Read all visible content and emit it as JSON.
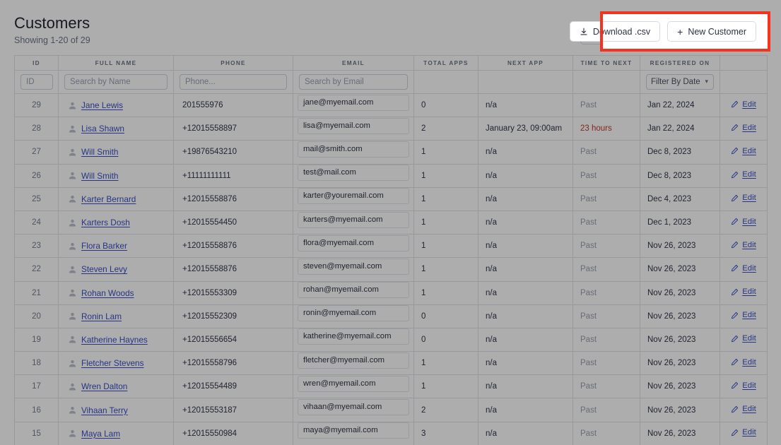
{
  "header": {
    "title": "Customers",
    "subtitle": "Showing 1-20 of 29",
    "download_label": "Download .csv",
    "new_customer_label": "New Customer",
    "download_icon": "download-icon",
    "new_icon": "plus-icon"
  },
  "highlight": {
    "color": "#f5321e"
  },
  "table": {
    "columns": [
      {
        "key": "id",
        "label": "ID"
      },
      {
        "key": "full_name",
        "label": "FULL NAME"
      },
      {
        "key": "phone",
        "label": "PHONE"
      },
      {
        "key": "email",
        "label": "EMAIL"
      },
      {
        "key": "total_apps",
        "label": "TOTAL APPS"
      },
      {
        "key": "next_app",
        "label": "NEXT APP"
      },
      {
        "key": "time_to_next",
        "label": "TIME TO NEXT"
      },
      {
        "key": "registered_on",
        "label": "REGISTERED ON"
      },
      {
        "key": "actions",
        "label": ""
      }
    ],
    "filters": {
      "id_placeholder": "ID",
      "name_placeholder": "Search by Name",
      "phone_placeholder": "Phone...",
      "email_placeholder": "Search by Email",
      "date_select_value": "Filter By Date"
    },
    "edit_label": "Edit",
    "rows": [
      {
        "id": "29",
        "full_name": "Jane Lewis",
        "phone": "201555976",
        "email": "jane@myemail.com",
        "total_apps": "0",
        "next_app": "n/a",
        "time_to_next": "Past",
        "time_state": "past",
        "registered_on": "Jan 22, 2024"
      },
      {
        "id": "28",
        "full_name": "Lisa Shawn",
        "phone": "+12015558897",
        "email": "lisa@myemail.com",
        "total_apps": "2",
        "next_app": "January 23, 09:00am",
        "time_to_next": "23 hours",
        "time_state": "soon",
        "registered_on": "Jan 22, 2024"
      },
      {
        "id": "27",
        "full_name": "Will Smith",
        "phone": "+19876543210",
        "email": "mail@smith.com",
        "total_apps": "1",
        "next_app": "n/a",
        "time_to_next": "Past",
        "time_state": "past",
        "registered_on": "Dec 8, 2023"
      },
      {
        "id": "26",
        "full_name": "Will Smith",
        "phone": "+11111111111",
        "email": "test@mail.com",
        "total_apps": "1",
        "next_app": "n/a",
        "time_to_next": "Past",
        "time_state": "past",
        "registered_on": "Dec 8, 2023"
      },
      {
        "id": "25",
        "full_name": "Karter Bernard",
        "phone": "+12015558876",
        "email": "karter@youremail.com",
        "total_apps": "1",
        "next_app": "n/a",
        "time_to_next": "Past",
        "time_state": "past",
        "registered_on": "Dec 4, 2023"
      },
      {
        "id": "24",
        "full_name": "Karters Dosh",
        "phone": "+12015554450",
        "email": "karters@myemail.com",
        "total_apps": "1",
        "next_app": "n/a",
        "time_to_next": "Past",
        "time_state": "past",
        "registered_on": "Dec 1, 2023"
      },
      {
        "id": "23",
        "full_name": "Flora Barker",
        "phone": "+12015558876",
        "email": "flora@myemail.com",
        "total_apps": "1",
        "next_app": "n/a",
        "time_to_next": "Past",
        "time_state": "past",
        "registered_on": "Nov 26, 2023"
      },
      {
        "id": "22",
        "full_name": "Steven Levy",
        "phone": "+12015558876",
        "email": "steven@myemail.com",
        "total_apps": "1",
        "next_app": "n/a",
        "time_to_next": "Past",
        "time_state": "past",
        "registered_on": "Nov 26, 2023"
      },
      {
        "id": "21",
        "full_name": "Rohan Woods",
        "phone": "+12015553309",
        "email": "rohan@myemail.com",
        "total_apps": "1",
        "next_app": "n/a",
        "time_to_next": "Past",
        "time_state": "past",
        "registered_on": "Nov 26, 2023"
      },
      {
        "id": "20",
        "full_name": "Ronin Lam",
        "phone": "+12015552309",
        "email": "ronin@myemail.com",
        "total_apps": "0",
        "next_app": "n/a",
        "time_to_next": "Past",
        "time_state": "past",
        "registered_on": "Nov 26, 2023"
      },
      {
        "id": "19",
        "full_name": "Katherine Haynes",
        "phone": "+12015556654",
        "email": "katherine@myemail.com",
        "total_apps": "0",
        "next_app": "n/a",
        "time_to_next": "Past",
        "time_state": "past",
        "registered_on": "Nov 26, 2023"
      },
      {
        "id": "18",
        "full_name": "Fletcher Stevens",
        "phone": "+12015558796",
        "email": "fletcher@myemail.com",
        "total_apps": "1",
        "next_app": "n/a",
        "time_to_next": "Past",
        "time_state": "past",
        "registered_on": "Nov 26, 2023"
      },
      {
        "id": "17",
        "full_name": "Wren Dalton",
        "phone": "+12015554489",
        "email": "wren@myemail.com",
        "total_apps": "1",
        "next_app": "n/a",
        "time_to_next": "Past",
        "time_state": "past",
        "registered_on": "Nov 26, 2023"
      },
      {
        "id": "16",
        "full_name": "Vihaan Terry",
        "phone": "+12015553187",
        "email": "vihaan@myemail.com",
        "total_apps": "2",
        "next_app": "n/a",
        "time_to_next": "Past",
        "time_state": "past",
        "registered_on": "Nov 26, 2023"
      },
      {
        "id": "15",
        "full_name": "Maya Lam",
        "phone": "+12015550984",
        "email": "maya@myemail.com",
        "total_apps": "3",
        "next_app": "n/a",
        "time_to_next": "Past",
        "time_state": "past",
        "registered_on": "Nov 26, 2023"
      }
    ]
  }
}
